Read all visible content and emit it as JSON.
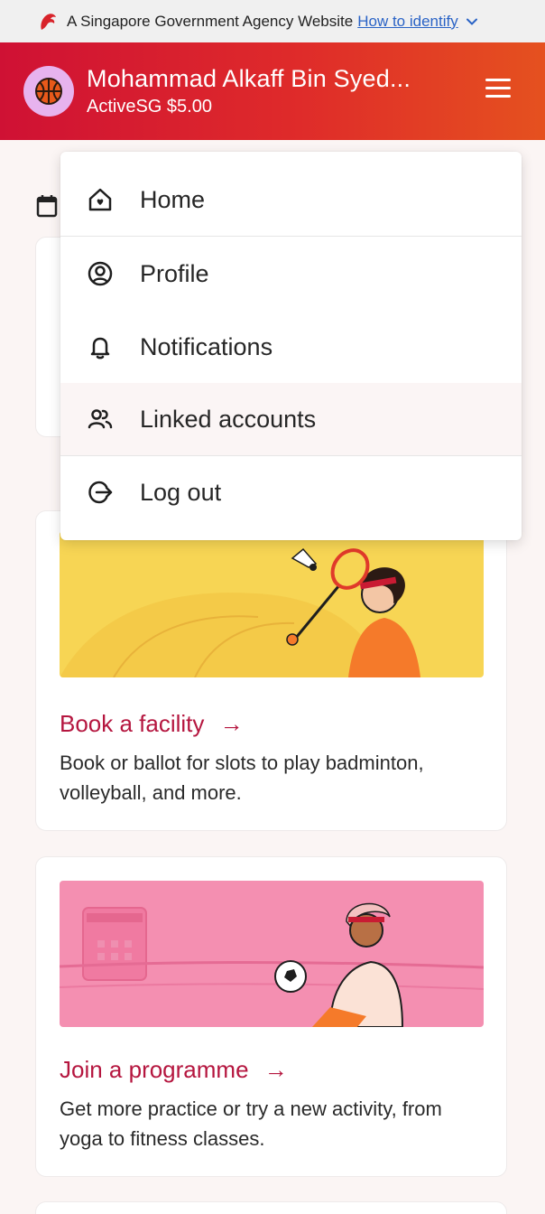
{
  "gov_banner": {
    "text": "A Singapore Government Agency Website",
    "link": "How to identify"
  },
  "header": {
    "name": "Mohammad Alkaff Bin Syed...",
    "credit": "ActiveSG $5.00"
  },
  "menu": {
    "items": [
      {
        "label": "Home",
        "icon": "home-icon"
      },
      {
        "label": "Profile",
        "icon": "user-circle-icon"
      },
      {
        "label": "Notifications",
        "icon": "bell-icon"
      },
      {
        "label": "Linked accounts",
        "icon": "users-icon"
      },
      {
        "label": "Log out",
        "icon": "logout-icon"
      }
    ]
  },
  "cards": {
    "facility": {
      "title": "Book a facility",
      "description": "Book or ballot for slots to play badminton, volleyball, and more."
    },
    "programme": {
      "title": "Join a programme",
      "description": "Get more practice or try a new activity, from yoga to fitness classes."
    }
  },
  "colors": {
    "brand_red": "#cf1134",
    "brand_orange": "#e5511f",
    "title_red": "#b5163f",
    "yellow_banner": "#f7d554",
    "pink_banner": "#f48fb1"
  }
}
